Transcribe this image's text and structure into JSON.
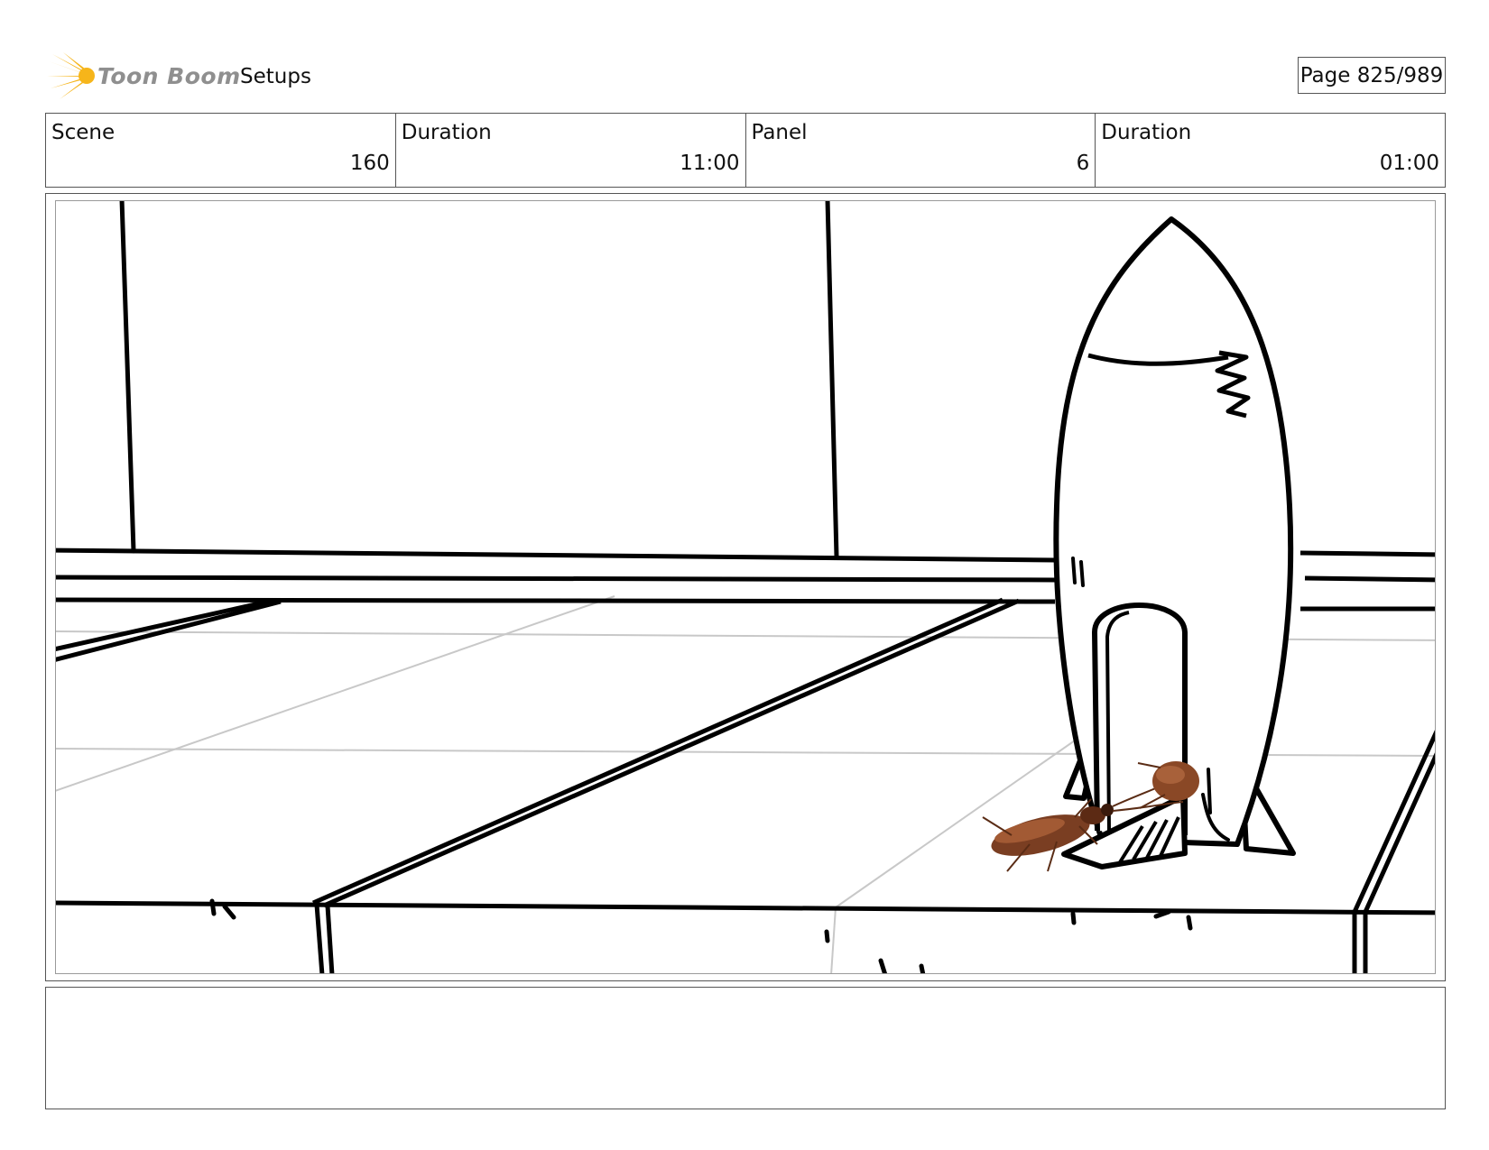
{
  "header": {
    "brand": "Toon Boom",
    "section": "Setups",
    "page": "Page 825/989",
    "logo_icon": "toon-boom-burst-logo",
    "logo_color": "#f6b51a"
  },
  "info": {
    "scene_label": "Scene",
    "scene_value": "160",
    "scene_duration_label": "Duration",
    "scene_duration_value": "11:00",
    "panel_label": "Panel",
    "panel_value": "6",
    "panel_duration_label": "Duration",
    "panel_duration_value": "01:00"
  },
  "panel": {
    "image_icon": "storyboard-sketch-rocket-cockroaches"
  },
  "notes": {
    "text": ""
  }
}
